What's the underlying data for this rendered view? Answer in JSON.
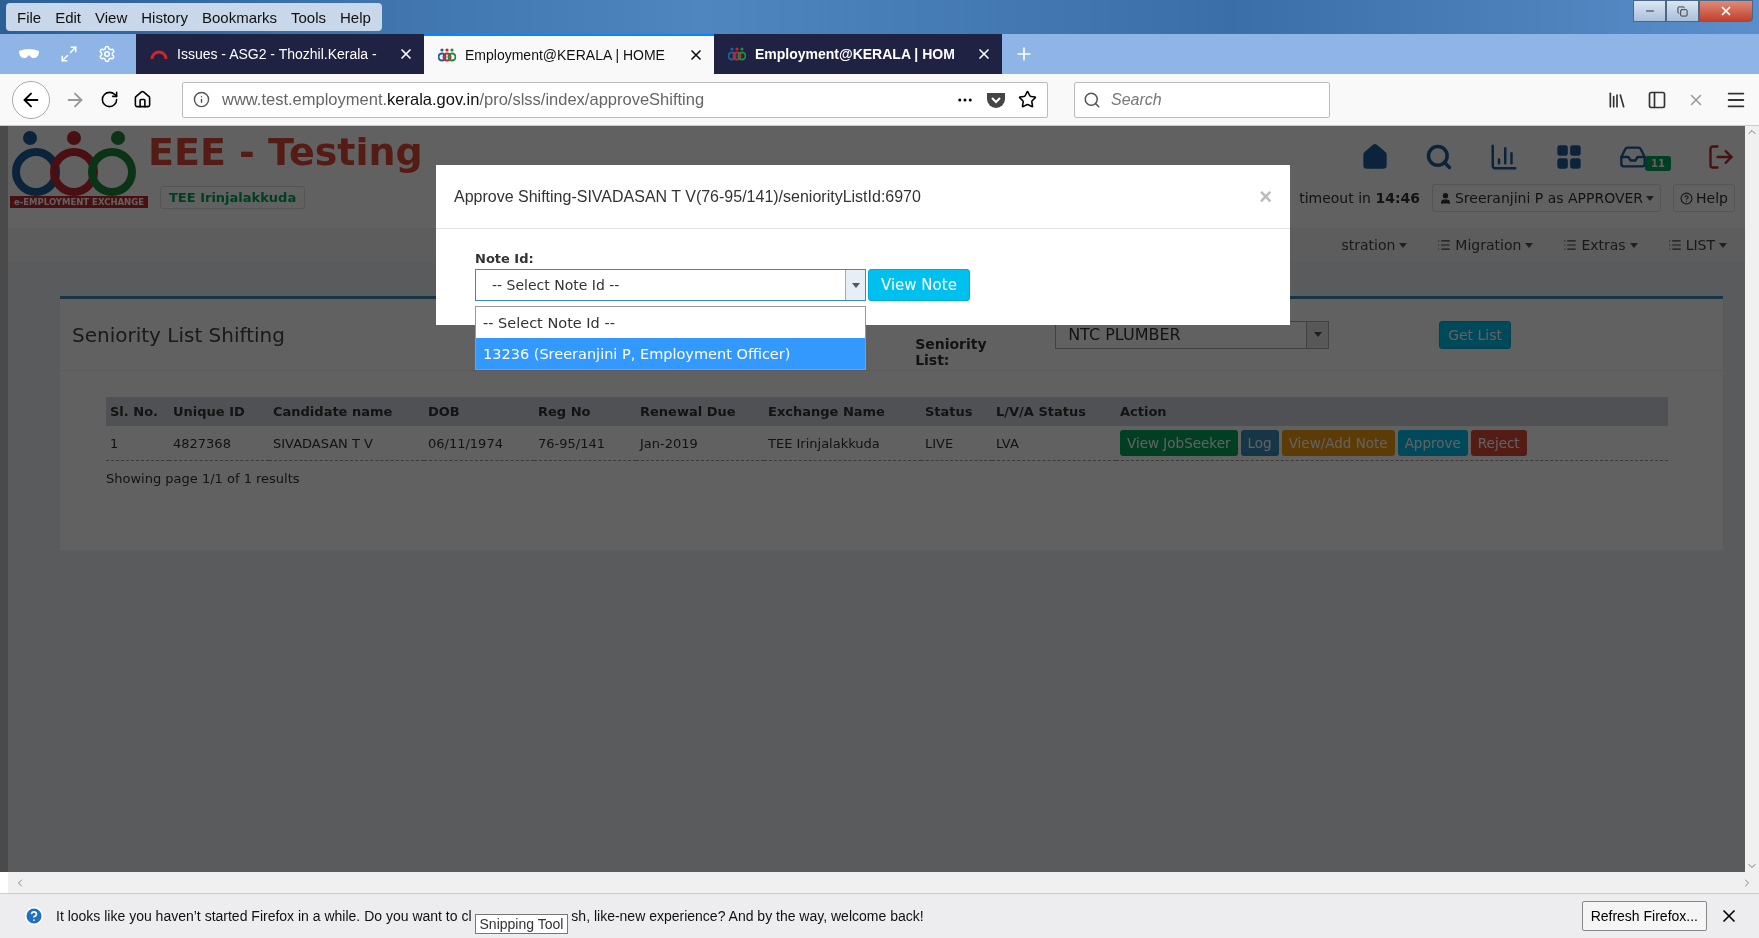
{
  "menu_bar": [
    "File",
    "Edit",
    "View",
    "History",
    "Bookmarks",
    "Tools",
    "Help"
  ],
  "tabs": [
    {
      "title": "Issues - ASG2 - Thozhil.Kerala -",
      "kind": "issues",
      "selected": false
    },
    {
      "title": "Employment@KERALA | HOME",
      "kind": "site",
      "selected": true
    },
    {
      "title": "Employment@KERALA | HOM",
      "kind": "site",
      "selected": false
    }
  ],
  "address_bar": {
    "prefix": "www.test.employment.",
    "domain": "kerala.gov.in",
    "path": "/pro/slss/index/approveShifting"
  },
  "search": {
    "placeholder": "Search"
  },
  "app": {
    "title": "EEE - Testing",
    "logo_caption": "e-EMPLOYMENT EXCHANGE",
    "office": "TEE Irinjalakkuda",
    "inbox_count": "11",
    "session": "timeout in **14:46**",
    "user": "Sreeranjini P as APPROVER",
    "help": "Help",
    "nav": [
      "stration",
      "Migration",
      "Extras",
      "LIST"
    ]
  },
  "panel": {
    "title": "Seniority List Shifting",
    "list_label": "Seniority List:",
    "list_value": "NTC PLUMBER",
    "get_list": "Get List",
    "table": {
      "columns": [
        "Sl. No.",
        "Unique ID",
        "Candidate name",
        "DOB",
        "Reg No",
        "Renewal Due",
        "Exchange Name",
        "Status",
        "L/V/A Status",
        "Action"
      ],
      "rows": [
        {
          "cells": [
            "1",
            "4827368",
            "SIVADASAN T V",
            "06/11/1974",
            "76-95/141",
            "Jan-2019",
            "TEE Irinjalakkuda",
            "LIVE",
            "LVA"
          ],
          "actions": [
            {
              "label": "View JobSeeker",
              "kind": "success"
            },
            {
              "label": "Log",
              "kind": "primary"
            },
            {
              "label": "View/Add Note",
              "kind": "warning"
            },
            {
              "label": "Approve",
              "kind": "info"
            },
            {
              "label": "Reject",
              "kind": "danger"
            }
          ]
        }
      ]
    },
    "footer": "Showing page 1/1 of 1 results"
  },
  "modal": {
    "title": "Approve Shifting-SIVADASAN T V(76-95/141)/seniorityListId:6970",
    "close": "×",
    "field_label": "Note Id:",
    "select_value": "-- Select Note Id --",
    "options": [
      {
        "label": "-- Select Note Id --",
        "selected": false
      },
      {
        "label": "13236 (Sreeranjini P, Employment Officer)",
        "selected": true
      }
    ],
    "button": "View Note"
  },
  "notification": {
    "text_before": "It looks like you haven’t started Firefox in a while. Do you want to cl",
    "text_after": "sh, like-new experience? And by the way, welcome back!",
    "button": "Refresh Firefox...",
    "tooltip": "Snipping Tool"
  }
}
